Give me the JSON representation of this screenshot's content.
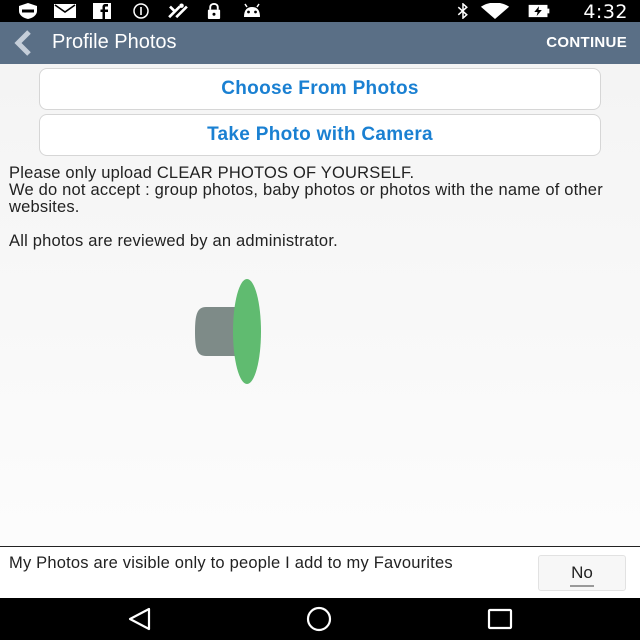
{
  "status_bar": {
    "time": "4:32",
    "icons": [
      "shield-icon",
      "mail-icon",
      "facebook-icon",
      "info-icon",
      "tools-icon",
      "lock-icon",
      "android-icon",
      "bluetooth-icon",
      "wifi-icon",
      "battery-icon"
    ]
  },
  "action_bar": {
    "title": "Profile Photos",
    "continue_label": "CONTINUE",
    "background": "#5a6f86"
  },
  "buttons": {
    "choose": "Choose From Photos",
    "camera": "Take Photo with Camera",
    "color": "#1a80d2"
  },
  "notice": {
    "line1": "Please only upload CLEAR PHOTOS OF YOURSELF.",
    "line2": "We do not accept : group photos, baby photos or photos with the name of other websites.",
    "reviewed": "All photos are reviewed by an administrator."
  },
  "visibility": {
    "text": "My Photos are visible only to people I add to my Favourites",
    "toggle_value": "No"
  },
  "nav_bar": {
    "icons": [
      "back-triangle-icon",
      "home-circle-icon",
      "recents-square-icon"
    ]
  }
}
